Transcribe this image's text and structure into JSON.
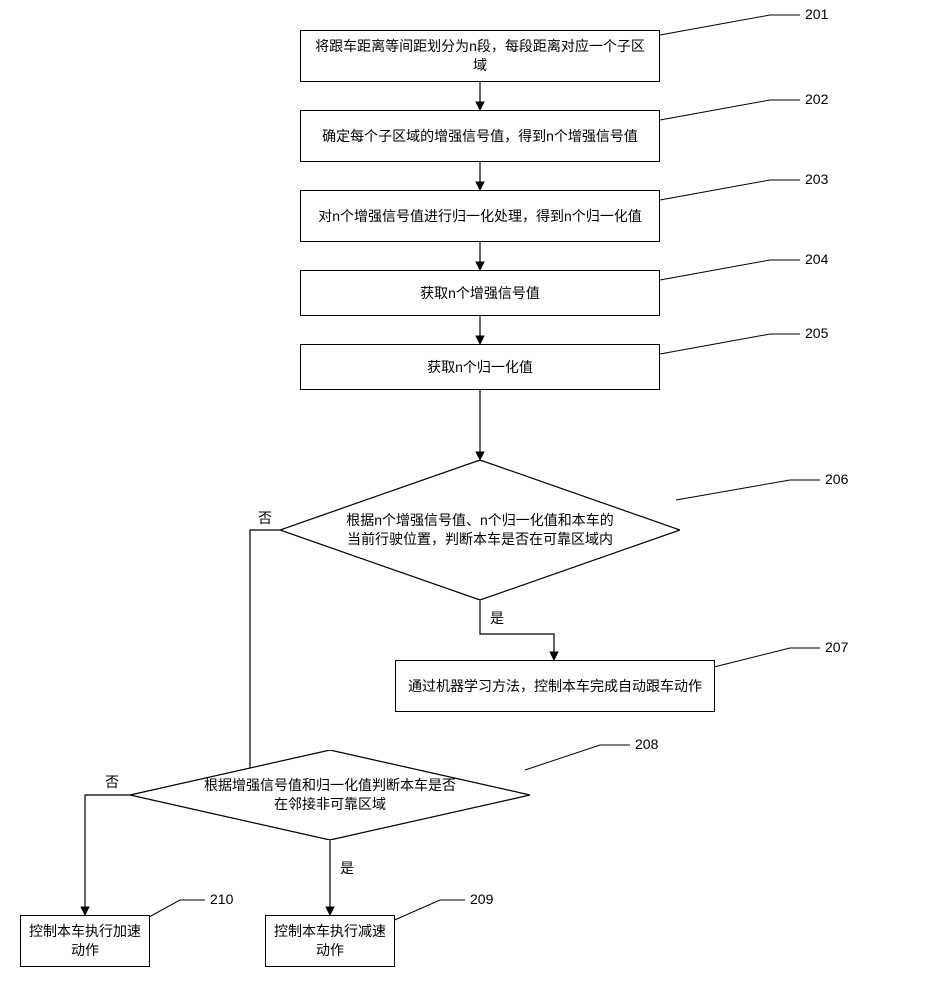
{
  "chart_data": {
    "type": "flowchart",
    "nodes": [
      {
        "id": "201",
        "kind": "process",
        "text": "将跟车距离等间距划分为n段，每段距离对应一个子区域"
      },
      {
        "id": "202",
        "kind": "process",
        "text": "确定每个子区域的增强信号值，得到n个增强信号值"
      },
      {
        "id": "203",
        "kind": "process",
        "text": "对n个增强信号值进行归一化处理，得到n个归一化值"
      },
      {
        "id": "204",
        "kind": "process",
        "text": "获取n个增强信号值"
      },
      {
        "id": "205",
        "kind": "process",
        "text": "获取n个归一化值"
      },
      {
        "id": "206",
        "kind": "decision",
        "text": "根据n个增强信号值、n个归一化值和本车的当前行驶位置，判断本车是否在可靠区域内"
      },
      {
        "id": "207",
        "kind": "process",
        "text": "通过机器学习方法，控制本车完成自动跟车动作"
      },
      {
        "id": "208",
        "kind": "decision",
        "text": "根据增强信号值和归一化值判断本车是否在邻接非可靠区域"
      },
      {
        "id": "209",
        "kind": "process",
        "text": "控制本车执行减速动作"
      },
      {
        "id": "210",
        "kind": "process",
        "text": "控制本车执行加速动作"
      }
    ],
    "edges": [
      {
        "from": "201",
        "to": "202"
      },
      {
        "from": "202",
        "to": "203"
      },
      {
        "from": "203",
        "to": "204"
      },
      {
        "from": "204",
        "to": "205"
      },
      {
        "from": "205",
        "to": "206"
      },
      {
        "from": "206",
        "to": "207",
        "label": "是"
      },
      {
        "from": "206",
        "to": "208",
        "label": "否"
      },
      {
        "from": "208",
        "to": "209",
        "label": "是"
      },
      {
        "from": "208",
        "to": "210",
        "label": "否"
      }
    ]
  },
  "labels": {
    "yes": "是",
    "no": "否"
  },
  "nodes": {
    "n201": {
      "num": "201",
      "text": "将跟车距离等间距划分为n段，每段距离对应一个子区域"
    },
    "n202": {
      "num": "202",
      "text": "确定每个子区域的增强信号值，得到n个增强信号值"
    },
    "n203": {
      "num": "203",
      "text": "对n个增强信号值进行归一化处理，得到n个归一化值"
    },
    "n204": {
      "num": "204",
      "text": "获取n个增强信号值"
    },
    "n205": {
      "num": "205",
      "text": "获取n个归一化值"
    },
    "n206": {
      "num": "206",
      "text": "根据n个增强信号值、n个归一化值和本车的当前行驶位置，判断本车是否在可靠区域内"
    },
    "n207": {
      "num": "207",
      "text": "通过机器学习方法，控制本车完成自动跟车动作"
    },
    "n208": {
      "num": "208",
      "text": "根据增强信号值和归一化值判断本车是否在邻接非可靠区域"
    },
    "n209": {
      "num": "209",
      "text": "控制本车执行减速动作"
    },
    "n210": {
      "num": "210",
      "text": "控制本车执行加速动作"
    }
  }
}
